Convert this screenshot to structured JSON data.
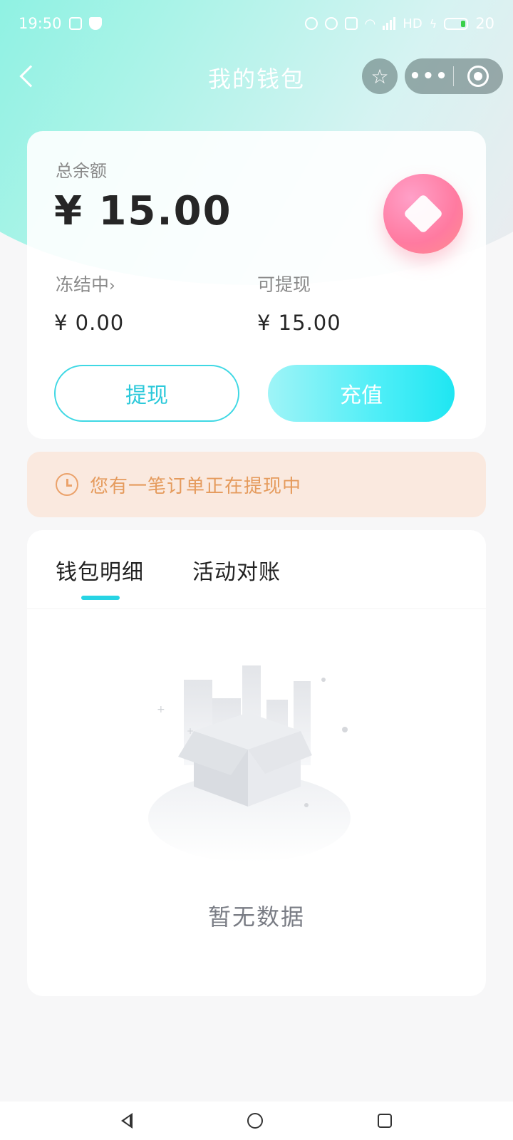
{
  "status_bar": {
    "time": "19:50",
    "network_label": "HD",
    "battery_level": "20"
  },
  "nav": {
    "title": "我的钱包"
  },
  "balance": {
    "total_label": "总余额",
    "total_amount": "¥ 15.00",
    "frozen_label": "冻结中",
    "frozen_chevron": "›",
    "frozen_amount": "¥ 0.00",
    "withdrawable_label": "可提现",
    "withdrawable_amount": "¥ 15.00",
    "withdraw_button": "提现",
    "recharge_button": "充值"
  },
  "notice": {
    "icon": "clock-icon",
    "text": "您有一笔订单正在提现中"
  },
  "details": {
    "tabs": [
      {
        "label": "钱包明细",
        "active": true
      },
      {
        "label": "活动对账",
        "active": false
      }
    ],
    "empty_text": "暂无数据"
  },
  "colors": {
    "accent": "#27d4e4",
    "notice_bg": "#fae9df",
    "notice_text": "#e59b5d",
    "badge": "#ff7aa0"
  }
}
